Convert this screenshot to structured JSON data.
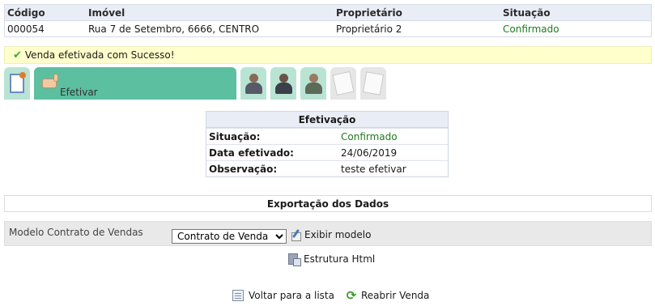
{
  "summary": {
    "headers": [
      "Código",
      "Imóvel",
      "Proprietário",
      "Situação"
    ],
    "row": [
      "000054",
      "Rua 7 de Setembro, 6666, CENTRO",
      "Proprietário 2",
      "Confirmado"
    ]
  },
  "message": "Venda efetivada com Sucesso!",
  "steps": {
    "active_label": "Efetivar"
  },
  "efetivacao": {
    "title": "Efetivação",
    "rows": [
      {
        "label": "Situação:",
        "value": "Confirmado"
      },
      {
        "label": "Data efetivado:",
        "value": "24/06/2019"
      },
      {
        "label": "Observação:",
        "value": "teste efetivar"
      }
    ]
  },
  "export": {
    "title": "Exportação dos Dados"
  },
  "modelo": {
    "label": "Modelo Contrato de Vendas",
    "selected": "Contrato de Venda",
    "exibir": "Exibir modelo"
  },
  "estrutura": "Estrutura Html",
  "actions": {
    "voltar": "Voltar para a lista",
    "reabrir": "Reabrir Venda"
  },
  "colors": {
    "accent": "#5bbfa0",
    "success": "#1f7a1f",
    "message_bg": "#ffffcc"
  }
}
